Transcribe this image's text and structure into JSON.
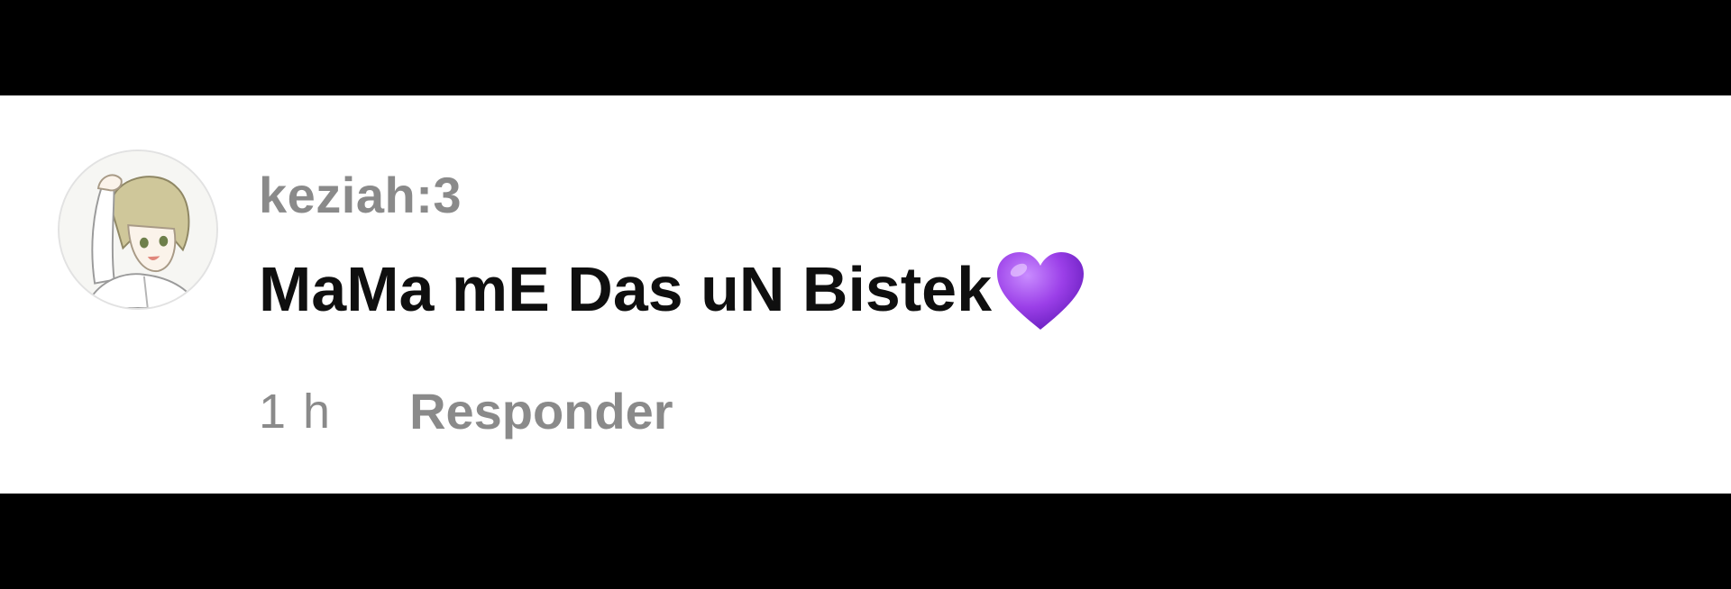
{
  "comment": {
    "avatar_icon": "user-avatar-anime-character",
    "username": "keziah:3",
    "text": "MaMa mE Das uN Bistek",
    "emoji": "purple-heart-icon",
    "timestamp": "1 h",
    "reply_label": "Responder"
  },
  "colors": {
    "background_bars": "#000000",
    "card": "#ffffff",
    "username": "#8a8a8a",
    "comment_text": "#0f0f0f",
    "meta": "#8a8a8a",
    "heart": "#9b3fe8"
  }
}
